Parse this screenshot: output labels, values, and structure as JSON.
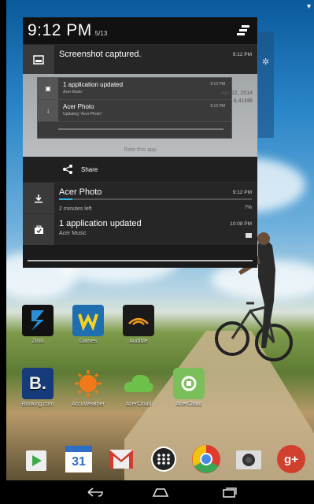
{
  "status_bar": {
    "time": "9:12 PM",
    "date": "5/13"
  },
  "notifications": {
    "screenshot": {
      "title": "Screenshot captured.",
      "time": "9:12 PM"
    },
    "preview": {
      "row1": {
        "title": "1 application updated",
        "sub": "Acer Music",
        "time": "9:12 PM"
      },
      "row2": {
        "title": "Acer Photo",
        "sub": "Updating \"Acer Photo\"",
        "time": "9:12 PM"
      },
      "side_date": "Apr 22, 2014",
      "side_size": "6.41MB",
      "rate": "Rate this app"
    },
    "share_label": "Share",
    "download": {
      "title": "Acer Photo",
      "time": "9:12 PM",
      "sub": "2 minutes left",
      "percent_label": "7%",
      "progress": 0.07
    },
    "updated": {
      "title": "1 application updated",
      "time": "10:08 PM",
      "sub": "Acer Music"
    }
  },
  "apps": [
    {
      "label": "Zinio",
      "icon": "zinio-icon"
    },
    {
      "label": "Games",
      "icon": "games-icon"
    },
    {
      "label": "Audible",
      "icon": "audible-icon"
    },
    {
      "label": "Booking.com",
      "icon": "booking-icon"
    },
    {
      "label": "AccuWeather",
      "icon": "accuweather-icon"
    },
    {
      "label": "AcerCloud",
      "icon": "acercloud-icon"
    },
    {
      "label": "AcerCloud",
      "icon": "acercloud-docs-icon"
    }
  ],
  "dock": {
    "calendar_day": "31",
    "gplus_label": "g+"
  },
  "colors": {
    "accent": "#33b5e5",
    "panel": "#1b1b1b"
  }
}
